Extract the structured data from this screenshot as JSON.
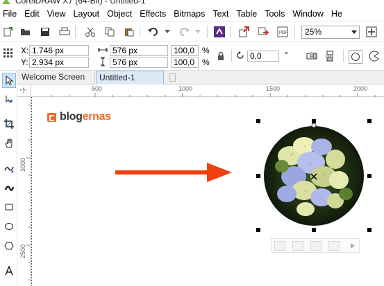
{
  "window": {
    "title": "CorelDRAW X7 (64-Bit) - Untitled-1"
  },
  "menu": [
    "File",
    "Edit",
    "View",
    "Layout",
    "Object",
    "Effects",
    "Bitmaps",
    "Text",
    "Table",
    "Tools",
    "Window",
    "He"
  ],
  "toolbar": {
    "zoom": "25%"
  },
  "properties": {
    "x_label": "X:",
    "x_value": "1.746 px",
    "y_label": "Y:",
    "y_value": "2.934 px",
    "width_value": "576 px",
    "height_value": "576 px",
    "scale_x": "100,0",
    "scale_y": "100,0",
    "pct_x": "%",
    "pct_y": "%",
    "rotation": "0,0",
    "degree": "°"
  },
  "tabs": [
    {
      "label": "Welcome Screen"
    },
    {
      "label": "Untitled-1"
    }
  ],
  "rulers": {
    "h_500": "500",
    "h_1000": "1000",
    "h_1500": "1500",
    "h_2000": "2000",
    "v_3000": "3000",
    "v_2500": "2500"
  },
  "canvas": {
    "logo_part1": "blog",
    "logo_part2": "ernas"
  },
  "colors": {
    "accent": "#f26a21",
    "arrow": "#f04010",
    "tab_active": "#dde9f6"
  }
}
